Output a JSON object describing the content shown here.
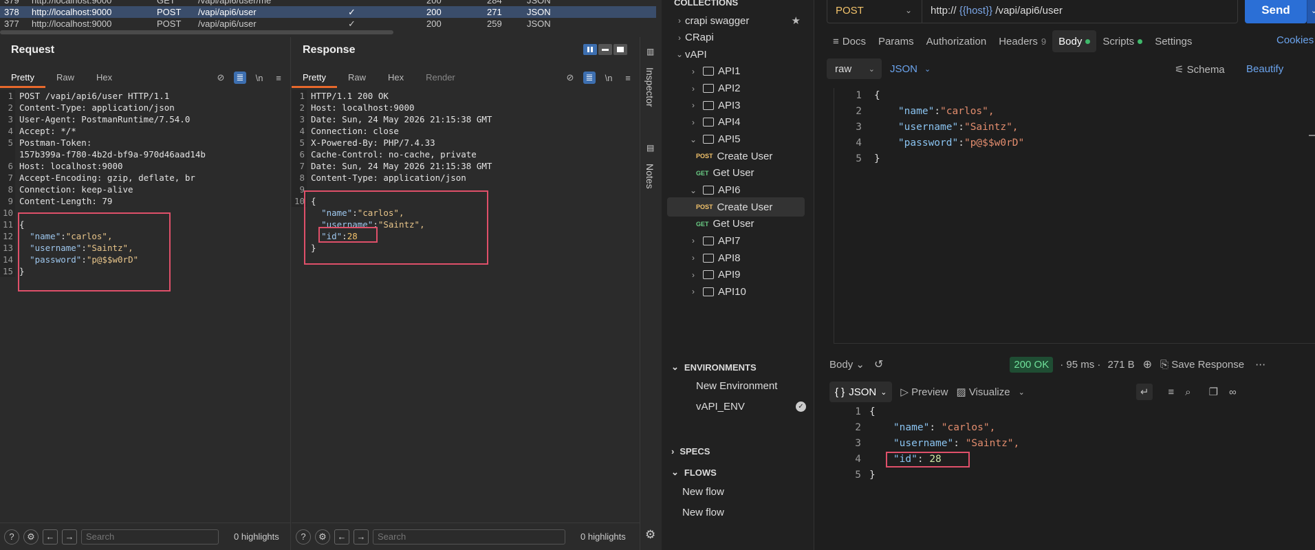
{
  "history": [
    {
      "num": "379",
      "host": "http://localhost:9000",
      "method": "GET",
      "url": "/vapi/api6/user/me",
      "edited": "",
      "status": "200",
      "len": "284",
      "mime": "JSON"
    },
    {
      "num": "378",
      "host": "http://localhost:9000",
      "method": "POST",
      "url": "/vapi/api6/user",
      "edited": "✓",
      "status": "200",
      "len": "271",
      "mime": "JSON"
    },
    {
      "num": "377",
      "host": "http://localhost:9000",
      "method": "POST",
      "url": "/vapi/api6/user",
      "edited": "✓",
      "status": "200",
      "len": "259",
      "mime": "JSON"
    }
  ],
  "request": {
    "title": "Request",
    "tabs": [
      "Pretty",
      "Raw",
      "Hex"
    ],
    "line_numbers": [
      "1",
      "2",
      "3",
      "4",
      "5",
      "",
      "6",
      "7",
      "8",
      "9",
      "10",
      "11",
      "12",
      "13",
      "14",
      "15"
    ],
    "lines": [
      "POST /vapi/api6/user HTTP/1.1",
      "Content-Type: application/json",
      "User-Agent: PostmanRuntime/7.54.0",
      "Accept: */*",
      "Postman-Token:",
      "157b399a-f780-4b2d-bf9a-970d46aad14b",
      "Host: localhost:9000",
      "Accept-Encoding: gzip, deflate, br",
      "Connection: keep-alive",
      "Content-Length: 79",
      "",
      "{"
    ],
    "body_lines": [
      {
        "key": "\"name\"",
        "val": "\"carlos\","
      },
      {
        "key": "\"username\"",
        "val": "\"Saintz\","
      },
      {
        "key": "\"password\"",
        "val": "\"p@$$w0rD\""
      }
    ],
    "close": "}"
  },
  "response": {
    "title": "Response",
    "tabs": [
      "Pretty",
      "Raw",
      "Hex",
      "Render"
    ],
    "line_numbers": [
      "1",
      "2",
      "3",
      "4",
      "5",
      "6",
      "7",
      "8",
      "9",
      "10"
    ],
    "lines": [
      "HTTP/1.1 200 OK",
      "Host: localhost:9000",
      "Date: Sun, 24 May 2026 21:15:38 GMT",
      "Connection: close",
      "X-Powered-By: PHP/7.4.33",
      "Cache-Control: no-cache, private",
      "Date: Sun, 24 May 2026 21:15:38 GMT",
      "Content-Type: application/json",
      "",
      "{"
    ],
    "body_lines": [
      {
        "key": "\"name\"",
        "val": "\"carlos\","
      },
      {
        "key": "\"username\"",
        "val": "\"Saintz\","
      },
      {
        "key": "\"id\"",
        "val": "28"
      }
    ],
    "close": "}"
  },
  "bottom": {
    "search_placeholder": "Search",
    "highlights": "0 highlights"
  },
  "side_tabs": [
    "Inspector",
    "Notes"
  ],
  "postman": {
    "collections_label": "COLLECTIONS",
    "tree": [
      {
        "label": "crapi swagger",
        "level": 0,
        "type": "coll",
        "star": "★"
      },
      {
        "label": "CRapi",
        "level": 0,
        "type": "coll"
      },
      {
        "label": "vAPI",
        "level": 0,
        "type": "coll-open"
      },
      {
        "label": "API1",
        "level": 1,
        "type": "folder"
      },
      {
        "label": "API2",
        "level": 1,
        "type": "folder"
      },
      {
        "label": "API3",
        "level": 1,
        "type": "folder"
      },
      {
        "label": "API4",
        "level": 1,
        "type": "folder"
      },
      {
        "label": "API5",
        "level": 1,
        "type": "folder-open"
      },
      {
        "label": "Create User",
        "level": 2,
        "type": "req",
        "method": "POST"
      },
      {
        "label": "Get User",
        "level": 2,
        "type": "req",
        "method": "GET"
      },
      {
        "label": "API6",
        "level": 1,
        "type": "folder-open"
      },
      {
        "label": "Create User",
        "level": 2,
        "type": "req",
        "method": "POST",
        "selected": true
      },
      {
        "label": "Get User",
        "level": 2,
        "type": "req",
        "method": "GET"
      },
      {
        "label": "API7",
        "level": 1,
        "type": "folder"
      },
      {
        "label": "API8",
        "level": 1,
        "type": "folder"
      },
      {
        "label": "API9",
        "level": 1,
        "type": "folder"
      },
      {
        "label": "API10",
        "level": 1,
        "type": "folder"
      }
    ],
    "environments_label": "ENVIRONMENTS",
    "environments": [
      "New Environment",
      "vAPI_ENV"
    ],
    "specs_label": "SPECS",
    "flows_label": "FLOWS",
    "flows": [
      "New flow",
      "New flow"
    ],
    "method": "POST",
    "url_prefix": "http:// ",
    "url_var": "{{host}}",
    "url_path": " /vapi/api6/user",
    "send": "Send",
    "req_tabs": [
      {
        "label": "Docs",
        "icon": "≡"
      },
      {
        "label": "Params"
      },
      {
        "label": "Authorization"
      },
      {
        "label": "Headers",
        "count": "9"
      },
      {
        "label": "Body",
        "dot": true,
        "active": true
      },
      {
        "label": "Scripts",
        "dot": true
      },
      {
        "label": "Settings"
      }
    ],
    "cookies": "Cookies",
    "body_mode": "raw",
    "body_format": "JSON",
    "schema": "Schema",
    "beautify": "Beautify",
    "req_body_nums": [
      "1",
      "2",
      "3",
      "4",
      "5"
    ],
    "req_body": {
      "open": "{",
      "lines": [
        {
          "key": "\"name\"",
          "val": "\"carlos\","
        },
        {
          "key": "\"username\"",
          "val": "\"Saintz\","
        },
        {
          "key": "\"password\"",
          "val": "\"p@$$w0rD\""
        }
      ],
      "close": "}"
    },
    "resp_label": "Body",
    "status": "200 OK",
    "time": "95 ms",
    "size": "271 B",
    "save_response": "Save Response",
    "resp_format": "JSON",
    "preview": "Preview",
    "visualize": "Visualize",
    "resp_body_nums": [
      "1",
      "2",
      "3",
      "4",
      "5"
    ],
    "resp_body": {
      "open": "{",
      "lines": [
        {
          "key": "\"name\"",
          "val": "\"carlos\","
        },
        {
          "key": "\"username\"",
          "val": "\"Saintz\","
        },
        {
          "key": "\"id\"",
          "val": "28"
        }
      ],
      "close": "}"
    }
  }
}
